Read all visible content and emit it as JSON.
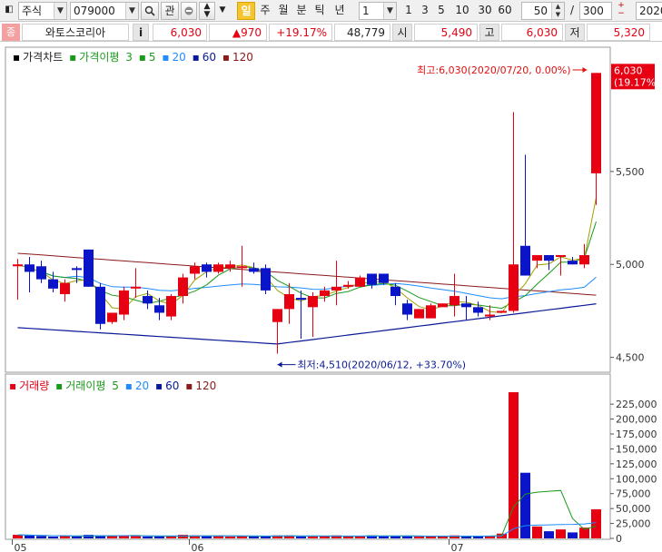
{
  "toolbar": {
    "market": "주식",
    "code": "079000",
    "btn_gwan": "관",
    "period_active": "일",
    "periods": [
      "주",
      "월",
      "분",
      "틱",
      "년"
    ],
    "interval_value": "1",
    "intervals": [
      "1",
      "3",
      "5",
      "10",
      "30",
      "60"
    ],
    "count_value": "50",
    "slash": "/",
    "total_value": "300",
    "date_value": "2020"
  },
  "info": {
    "badge": "종",
    "name": "와토스코리아",
    "info_btn": "i",
    "price": "6,030",
    "change": "▲970",
    "change_pct": "+19.17%",
    "volume": "48,779",
    "open_label": "시",
    "open": "5,490",
    "high_label": "고",
    "high": "6,030",
    "low_label": "저",
    "low": "5,320"
  },
  "legend_price": {
    "title": "가격차트",
    "ma_label": "가격이평",
    "periods": [
      "3",
      "5",
      "20",
      "60",
      "120"
    ]
  },
  "legend_volume": {
    "title": "거래량",
    "ma_label": "거래이평",
    "periods": [
      "5",
      "20",
      "60",
      "120"
    ]
  },
  "annotations": {
    "high": "최고:6,030(2020/07/20, 0.00%)",
    "low": "최저:4,510(2020/06/12, +33.70%)",
    "last_price": "6,030",
    "last_pct": "(19.17%)"
  },
  "colors": {
    "up": "#e60012",
    "down": "#0a14c8",
    "ma3": "#1a9a1a",
    "ma5": "#1a9a1a",
    "ma20": "#1e8cff",
    "ma60": "#0a1a96",
    "ma120": "#8b1a1a"
  },
  "chart_data": {
    "type": "candlestick",
    "price_axis": {
      "ticks": [
        "5,500",
        "5,000",
        "4,500"
      ],
      "tick_values": [
        5500,
        5000,
        4500
      ],
      "range": [
        4420,
        6100
      ]
    },
    "volume_axis": {
      "ticks": [
        "225,000",
        "200,000",
        "175,000",
        "150,000",
        "125,000",
        "100,000",
        "75,000",
        "50,000",
        "25,000",
        "0"
      ],
      "tick_values": [
        225000,
        200000,
        175000,
        150000,
        125000,
        100000,
        75000,
        50000,
        25000,
        0
      ],
      "range": [
        0,
        245000
      ]
    },
    "x_labels": [
      {
        "index": 0,
        "label": "05"
      },
      {
        "index": 15,
        "label": "06"
      },
      {
        "index": 37,
        "label": "07"
      }
    ],
    "candles": [
      [
        4990,
        5030,
        4810,
        5000,
        6000
      ],
      [
        5000,
        5040,
        4850,
        4960,
        5000
      ],
      [
        4990,
        5020,
        4900,
        4920,
        4000
      ],
      [
        4920,
        4960,
        4850,
        4870,
        3000
      ],
      [
        4840,
        4920,
        4800,
        4900,
        4000
      ],
      [
        4980,
        4990,
        4900,
        4970,
        3000
      ],
      [
        5080,
        5080,
        4880,
        4880,
        6000
      ],
      [
        4880,
        4900,
        4650,
        4680,
        5000
      ],
      [
        4690,
        4740,
        4680,
        4740,
        4000
      ],
      [
        4730,
        4880,
        4700,
        4860,
        5000
      ],
      [
        4880,
        4980,
        4820,
        4880,
        4000
      ],
      [
        4830,
        4860,
        4760,
        4790,
        3000
      ],
      [
        4780,
        4820,
        4700,
        4740,
        3000
      ],
      [
        4720,
        4840,
        4700,
        4830,
        3000
      ],
      [
        4830,
        4950,
        4790,
        4930,
        6000
      ],
      [
        4950,
        5010,
        4920,
        4990,
        5000
      ],
      [
        5000,
        5010,
        4930,
        4960,
        4000
      ],
      [
        4960,
        5010,
        4950,
        5000,
        4000
      ],
      [
        4980,
        5020,
        4960,
        5000,
        3000
      ],
      [
        4980,
        5100,
        4880,
        4990,
        4000
      ],
      [
        4980,
        5010,
        4950,
        4960,
        3000
      ],
      [
        4980,
        5000,
        4840,
        4860,
        4000
      ],
      [
        4690,
        4760,
        4520,
        4760,
        5000
      ],
      [
        4760,
        4900,
        4680,
        4840,
        5000
      ],
      [
        4820,
        4860,
        4600,
        4810,
        3000
      ],
      [
        4770,
        4850,
        4610,
        4830,
        3000
      ],
      [
        4830,
        4880,
        4800,
        4860,
        4000
      ],
      [
        4860,
        5020,
        4780,
        4880,
        5000
      ],
      [
        4880,
        4910,
        4870,
        4890,
        3000
      ],
      [
        4880,
        4940,
        4880,
        4930,
        4000
      ],
      [
        4950,
        4950,
        4870,
        4890,
        5000
      ],
      [
        4950,
        4950,
        4890,
        4900,
        4000
      ],
      [
        4880,
        4900,
        4780,
        4830,
        4000
      ],
      [
        4790,
        4810,
        4700,
        4730,
        4000
      ],
      [
        4710,
        4760,
        4710,
        4760,
        3000
      ],
      [
        4710,
        4790,
        4710,
        4780,
        3000
      ],
      [
        4770,
        4790,
        4780,
        4790,
        3000
      ],
      [
        4780,
        4950,
        4720,
        4830,
        5000
      ],
      [
        4790,
        4830,
        4700,
        4770,
        3000
      ],
      [
        4770,
        4800,
        4720,
        4740,
        4000
      ],
      [
        4720,
        4780,
        4700,
        4730,
        4000
      ],
      [
        4740,
        4750,
        4740,
        4750,
        8000
      ],
      [
        4750,
        5820,
        4740,
        5000,
        245000
      ],
      [
        5100,
        5590,
        4940,
        4940,
        110000
      ],
      [
        5020,
        5050,
        4980,
        5050,
        20000
      ],
      [
        5050,
        5050,
        4970,
        5020,
        12000
      ],
      [
        5050,
        5050,
        4940,
        5050,
        15000
      ],
      [
        5020,
        5040,
        5000,
        5000,
        10000
      ],
      [
        5000,
        5110,
        4980,
        5050,
        18000
      ],
      [
        5490,
        6030,
        5320,
        6030,
        48779
      ]
    ]
  }
}
